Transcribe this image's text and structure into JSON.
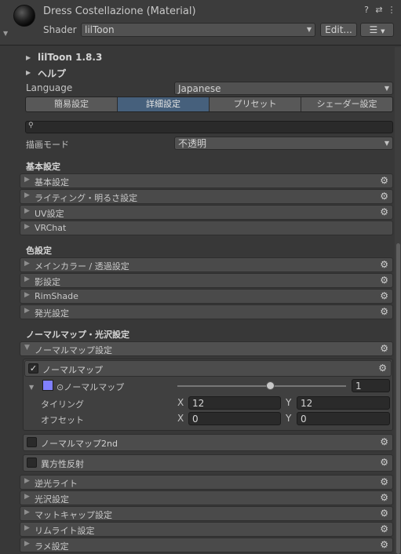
{
  "header": {
    "title": "Dress Costellazione (Material)",
    "shader_label": "Shader",
    "shader_value": "lilToon",
    "edit_label": "Edit...",
    "help_icon": "?",
    "preset_icon": "⇄",
    "menu_icon": "⋮",
    "list_icon": "☰"
  },
  "top": {
    "version": "lilToon 1.8.3",
    "help": "ヘルプ",
    "language_label": "Language",
    "language_value": "Japanese",
    "tabs": [
      "簡易設定",
      "詳細設定",
      "プリセット",
      "シェーダー設定"
    ],
    "search_icon": "🔍",
    "render_mode_label": "描画モード",
    "render_mode_value": "不透明"
  },
  "basic": {
    "title": "基本設定",
    "items": [
      "基本設定",
      "ライティング・明るさ設定",
      "UV設定",
      "VRChat"
    ]
  },
  "color": {
    "title": "色設定",
    "items": [
      "メインカラー / 透過設定",
      "影設定",
      "RimShade",
      "発光設定"
    ]
  },
  "normal": {
    "title": "ノーマルマップ・光沢設定",
    "group": "ノーマルマップ設定",
    "normal_map": "ノーマルマップ",
    "normal_map_prop": "⊙ノーマルマップ",
    "strength": "1",
    "tiling_label": "タイリング",
    "tiling_x": "12",
    "tiling_y": "12",
    "offset_label": "オフセット",
    "offset_x": "0",
    "offset_y": "0",
    "x": "X",
    "y": "Y",
    "normal_map_2nd": "ノーマルマップ2nd",
    "anisotropy": "異方性反射",
    "items": [
      "逆光ライト",
      "光沢設定",
      "マットキャップ設定",
      "リムライト設定",
      "ラメ設定"
    ]
  },
  "colors": {
    "accent_tab": "#46607c",
    "swatch": "#8080ff"
  }
}
